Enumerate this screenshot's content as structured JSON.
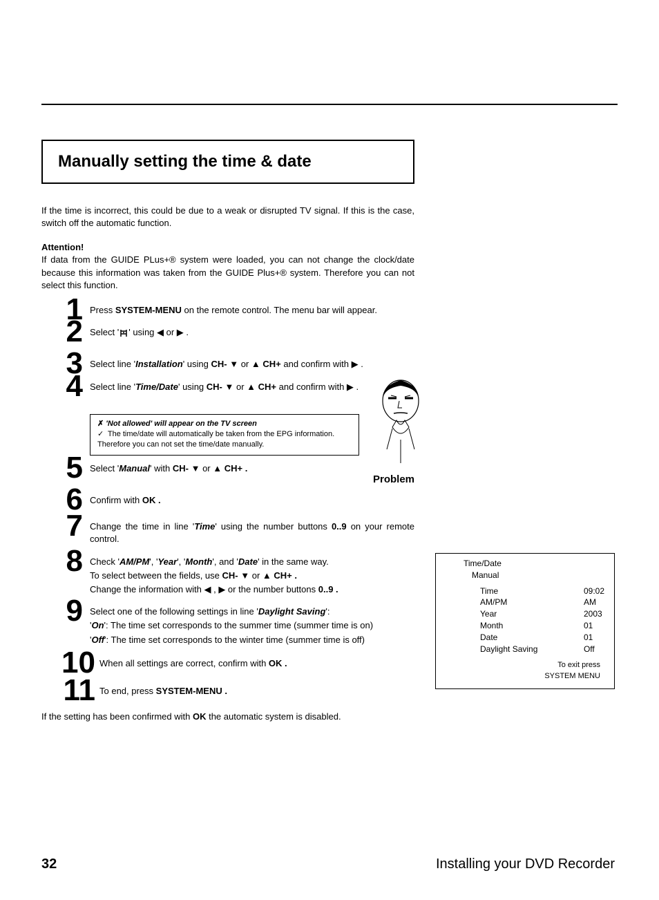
{
  "title": "Manually setting the time & date",
  "intro": "If the time is incorrect, this could be due to a weak or disrupted TV signal. If this is the case, switch off the automatic function.",
  "attention_label": "Attention!",
  "attention_text": "If data from the GUIDE PLus+® system were loaded, you can not change the clock/date because this information was taken from the GUIDE Plus+® system. Therefore you can not select this function.",
  "step1_a": "Press ",
  "step1_b": "SYSTEM-MENU",
  "step1_c": " on the remote control. The menu bar will appear.",
  "step2_a": "Select '",
  "step2_b": "' using ◀ or ▶ .",
  "step3_a": "Select line '",
  "step3_b": "Installation",
  "step3_c": "' using ",
  "step3_d": "CH- ▼",
  "step3_e": " or ",
  "step3_f": "▲ CH+",
  "step3_g": " and confirm with ▶ .",
  "step4_a": "Select line '",
  "step4_b": "Time/Date",
  "step4_c": "' using ",
  "step4_d": "CH- ▼",
  "step4_e": " or ",
  "step4_f": "▲ CH+",
  "step4_g": " and confirm with ▶ .",
  "problem_x": "✗ ",
  "problem_title": "'Not allowed' will appear on the TV screen",
  "problem_check": "✓",
  "problem_body": " The time/date will automatically be taken from the EPG information. Therefore you can not set the time/date manually.",
  "problem_label": "Problem",
  "step5_a": "Select '",
  "step5_b": "Manual",
  "step5_c": "' with ",
  "step5_d": "CH- ▼",
  "step5_e": " or ",
  "step5_f": "▲ CH+ .",
  "step6_a": "Confirm with ",
  "step6_b": "OK .",
  "step7_a": "Change the time in line '",
  "step7_b": "Time",
  "step7_c": "' using the number buttons ",
  "step7_d": "0..9",
  "step7_e": " on your remote control.",
  "step8_a": "Check '",
  "step8_b": "AM/PM",
  "step8_c": "', '",
  "step8_d": "Year",
  "step8_e": "', '",
  "step8_f": "Month",
  "step8_g": "', and '",
  "step8_h": "Date",
  "step8_i": "' in the same way.",
  "step8_2a": "To select between the fields, use ",
  "step8_2b": "CH- ▼",
  "step8_2c": " or ",
  "step8_2d": "▲ CH+ .",
  "step8_3a": "Change the information with ◀ , ▶ or the number buttons ",
  "step8_3b": "0..9 .",
  "step9_a": "Select one of the following settings in line '",
  "step9_b": "Daylight Saving",
  "step9_c": "':",
  "step9_on_a": "'",
  "step9_on_b": "On",
  "step9_on_c": "': The time set corresponds to the summer time (summer time is on)",
  "step9_off_a": "'",
  "step9_off_b": "Off",
  "step9_off_c": "': The time set corresponds to the winter time (summer time is off)",
  "step10_a": "When all settings are correct, confirm with ",
  "step10_b": "OK .",
  "step11_a": "To end, press ",
  "step11_b": "SYSTEM-MENU .",
  "closing_a": "If the setting has been confirmed with ",
  "closing_b": "OK",
  "closing_c": " the automatic system is disabled.",
  "osd": {
    "title": "Time/Date",
    "sub": "Manual",
    "labels": {
      "time": "Time",
      "ampm": "AM/PM",
      "year": "Year",
      "month": "Month",
      "date": "Date",
      "ds": "Daylight Saving"
    },
    "values": {
      "time": "09:02",
      "ampm": "AM",
      "year": "2003",
      "month": "01",
      "date": "01",
      "ds": "Off"
    },
    "exit1": "To exit press",
    "exit2": "SYSTEM MENU"
  },
  "page_num": "32",
  "footer_title": "Installing your DVD Recorder"
}
